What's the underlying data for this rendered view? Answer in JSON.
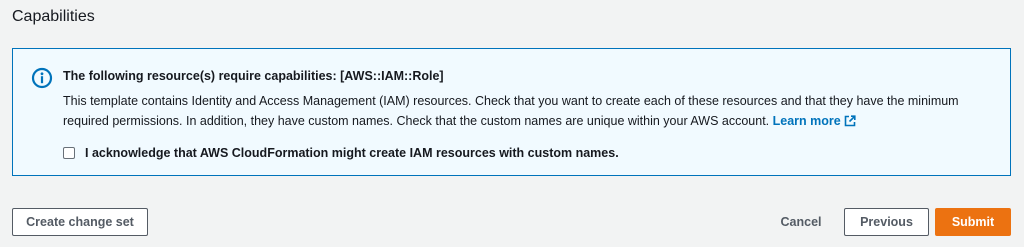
{
  "section": {
    "title": "Capabilities"
  },
  "alert": {
    "icon": "info-icon",
    "heading": "The following resource(s) require capabilities: [AWS::IAM::Role]",
    "body": "This template contains Identity and Access Management (IAM) resources. Check that you want to create each of these resources and that they have the minimum required permissions. In addition, they have custom names. Check that the custom names are unique within your AWS account.",
    "learn_more": "Learn more",
    "learn_more_icon": "external-link-icon",
    "border_color": "#0073bb",
    "background_color": "#f1faff"
  },
  "acknowledge": {
    "label": "I acknowledge that AWS CloudFormation might create IAM resources with custom names.",
    "checked": false
  },
  "footer": {
    "create_change_set_label": "Create change set",
    "cancel_label": "Cancel",
    "previous_label": "Previous",
    "submit_label": "Submit",
    "primary_color": "#ec7211"
  }
}
